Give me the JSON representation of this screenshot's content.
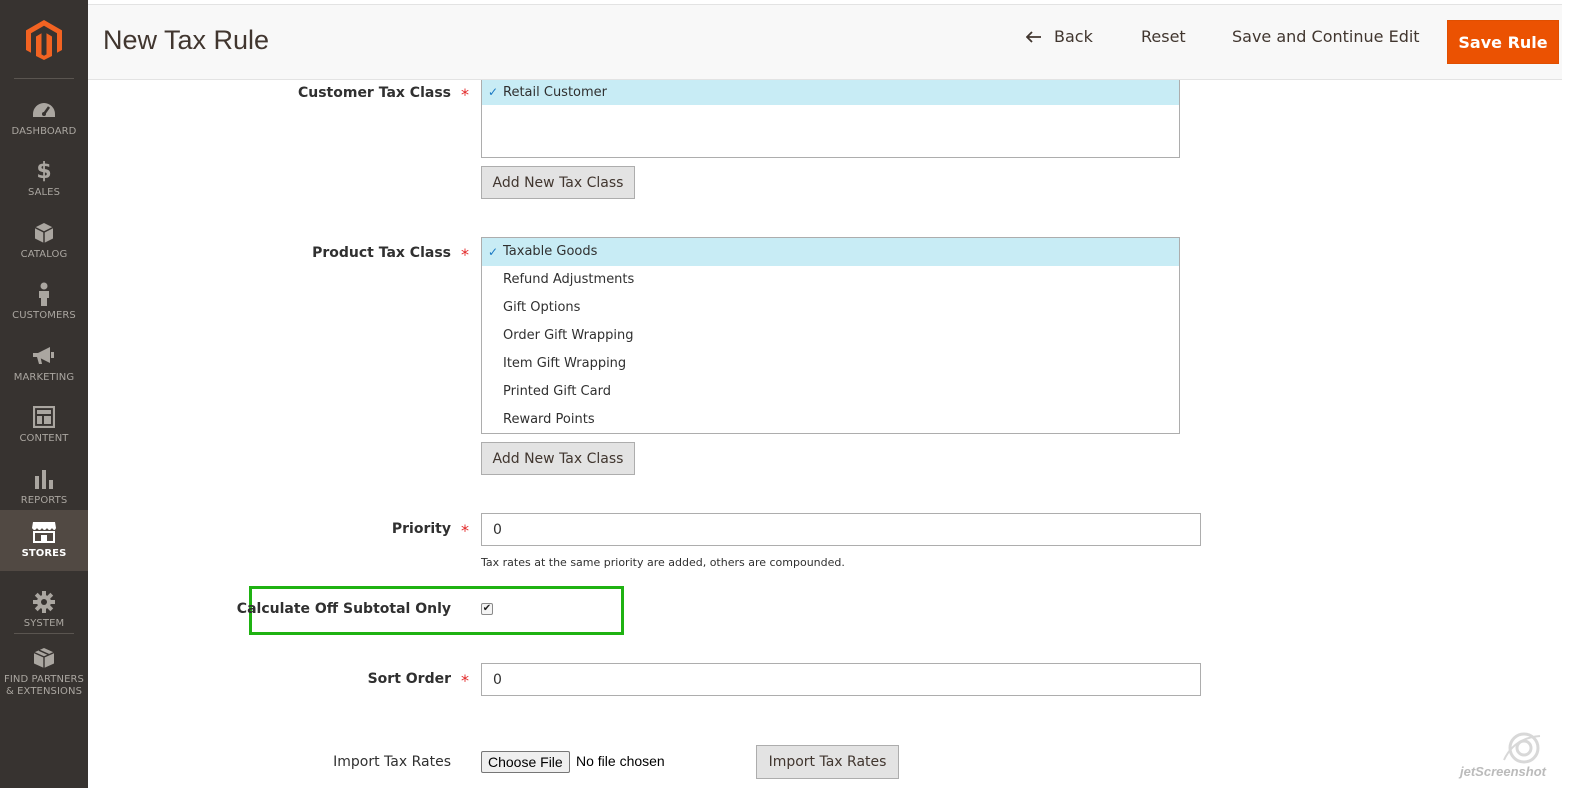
{
  "sidebar": {
    "items": [
      {
        "label": "DASHBOARD",
        "icon": "dashboard-icon"
      },
      {
        "label": "SALES",
        "icon": "dollar-icon"
      },
      {
        "label": "CATALOG",
        "icon": "box-icon"
      },
      {
        "label": "CUSTOMERS",
        "icon": "person-icon"
      },
      {
        "label": "MARKETING",
        "icon": "megaphone-icon"
      },
      {
        "label": "CONTENT",
        "icon": "layout-icon"
      },
      {
        "label": "REPORTS",
        "icon": "bar-chart-icon"
      },
      {
        "label": "STORES",
        "icon": "store-icon"
      },
      {
        "label": "SYSTEM",
        "icon": "gear-icon"
      },
      {
        "label": "FIND PARTNERS & EXTENSIONS",
        "icon": "cubes-icon"
      }
    ],
    "active": "STORES"
  },
  "header": {
    "title": "New Tax Rule",
    "back_label": "Back",
    "reset_label": "Reset",
    "save_continue_label": "Save and Continue Edit",
    "save_label": "Save Rule"
  },
  "form": {
    "customer_tax_class": {
      "label": "Customer Tax Class",
      "options": [
        {
          "text": "Retail Customer",
          "selected": true
        }
      ],
      "add_label": "Add New Tax Class"
    },
    "product_tax_class": {
      "label": "Product Tax Class",
      "options": [
        {
          "text": "Taxable Goods",
          "selected": true
        },
        {
          "text": "Refund Adjustments",
          "selected": false
        },
        {
          "text": "Gift Options",
          "selected": false
        },
        {
          "text": "Order Gift Wrapping",
          "selected": false
        },
        {
          "text": "Item Gift Wrapping",
          "selected": false
        },
        {
          "text": "Printed Gift Card",
          "selected": false
        },
        {
          "text": "Reward Points",
          "selected": false
        }
      ],
      "add_label": "Add New Tax Class"
    },
    "priority": {
      "label": "Priority",
      "value": "0",
      "note": "Tax rates at the same priority are added, others are compounded."
    },
    "calculate_subtotal": {
      "label": "Calculate Off Subtotal Only",
      "checked": true
    },
    "sort_order": {
      "label": "Sort Order",
      "value": "0"
    },
    "import_tax_rates": {
      "label": "Import Tax Rates",
      "choose_file_label": "Choose File",
      "file_status": "No file chosen",
      "import_label": "Import Tax Rates"
    },
    "required_mark": "*"
  },
  "watermark": "jetScreenshot",
  "colors": {
    "sidebar_bg": "#373330",
    "sidebar_active": "#514943",
    "accent_orange": "#eb5202",
    "logo_orange": "#f26322",
    "selected_option": "#c8ecf5",
    "highlight_green": "#1fb212"
  }
}
